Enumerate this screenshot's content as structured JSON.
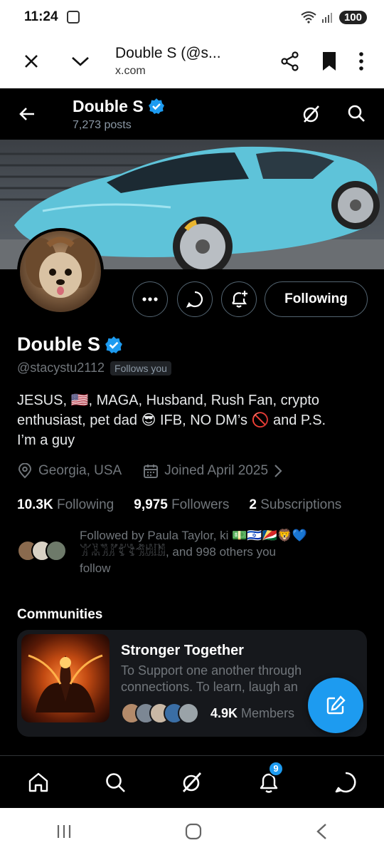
{
  "status_bar": {
    "time": "11:24",
    "battery": "100"
  },
  "browser": {
    "title": "Double S (@s...",
    "url": "x.com"
  },
  "header": {
    "name": "Double S",
    "posts": "7,273 posts"
  },
  "profile": {
    "display_name": "Double S",
    "handle": "@stacystu2112",
    "follows_you": "Follows you",
    "following_button": "Following",
    "bio_line1": "JESUS, 🇺🇸, MAGA, Husband, Rush Fan, crypto",
    "bio_line2": "enthusiast, pet dad 😎 IFB, NO DM’s 🚫 and P.S.",
    "bio_line3": "I’m a guy",
    "location": "Georgia, USA",
    "joined": "Joined April 2025",
    "following_count": "10.3K",
    "following_label": "Following",
    "followers_count": "9,975",
    "followers_label": "Followers",
    "subscriptions_count": "2",
    "subscriptions_label": "Subscriptions",
    "followed_by_line1": "Followed by Paula Taylor, ki 💵🇮🇱🇸🇨🦁💙",
    "followed_by_line2": "𓀠𓀡𓀢𓀣𓀤𓀥𓀦𓀧𓀨, and 998 others you",
    "followed_by_line3": "follow"
  },
  "communities": {
    "section_title": "Communities",
    "name": "Stronger Together",
    "desc_line1": "To Support one another through",
    "desc_line2": "connections. To learn, laugh an",
    "members_count": "4.9K",
    "members_label": "Members"
  },
  "nav": {
    "notifications_badge": "9"
  },
  "colors": {
    "accent": "#1d9bf0",
    "background": "#000000",
    "muted": "#71767b"
  },
  "icons": [
    "close-icon",
    "chevron-down-icon",
    "share-icon",
    "bookmark-icon",
    "more-vert-icon",
    "back-arrow-icon",
    "verified-badge-icon",
    "grok-icon",
    "search-icon",
    "more-horiz-icon",
    "message-icon",
    "bell-plus-icon",
    "location-icon",
    "calendar-icon",
    "chevron-right-icon",
    "compose-icon",
    "home-icon",
    "bell-icon",
    "menu-lines-icon",
    "circle-home-icon",
    "back-chevron-icon"
  ]
}
